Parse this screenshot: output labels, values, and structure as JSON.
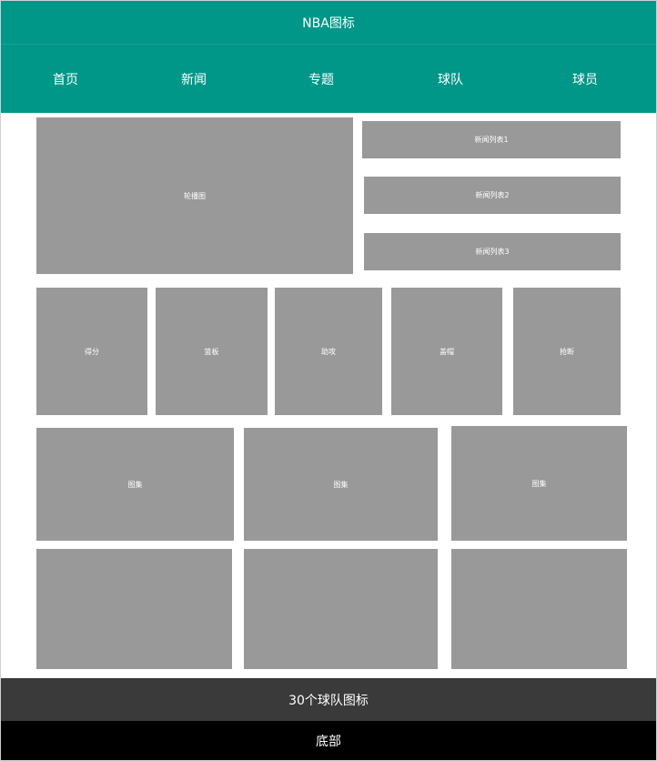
{
  "header": {
    "title": "NBA图标"
  },
  "nav": {
    "items": [
      "首页",
      "新闻",
      "专题",
      "球队",
      "球员"
    ]
  },
  "carousel": {
    "label": "轮播图"
  },
  "news": {
    "items": [
      "新闻列表1",
      "新闻列表2",
      "新闻列表3"
    ]
  },
  "stats": {
    "items": [
      "得分",
      "篮板",
      "助攻",
      "盖帽",
      "抢断"
    ]
  },
  "gallery": {
    "items": [
      "图集",
      "图集",
      "图集",
      "",
      "",
      ""
    ]
  },
  "teams_band": {
    "label": "30个球队图标"
  },
  "footer": {
    "label": "底部"
  },
  "colors": {
    "primary": "#009688",
    "placeholder": "#999999",
    "band": "#3a3a3a",
    "footer": "#000000"
  }
}
